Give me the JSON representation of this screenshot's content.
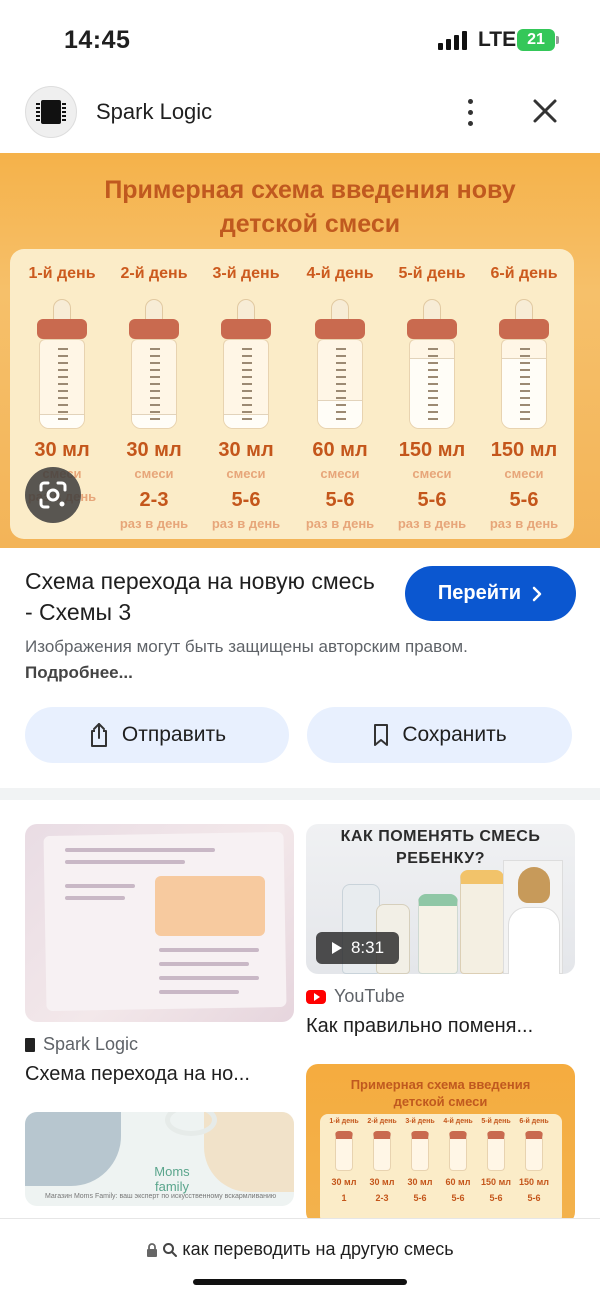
{
  "status_bar": {
    "time": "14:45",
    "network": "LTE",
    "battery": "21",
    "battery_color": "#34c759"
  },
  "header": {
    "source_name": "Spark Logic",
    "logo_icon": "chip-icon",
    "more_icon": "more-vert-icon",
    "close_icon": "close-icon"
  },
  "main_image": {
    "title_line1": "Примерная схема введения нову",
    "title_line2": "детской смеси",
    "columns": [
      {
        "day": "1-й день",
        "volume": "30 мл",
        "label": "смеси",
        "times": "",
        "per_day": "раз в день"
      },
      {
        "day": "2-й день",
        "volume": "30 мл",
        "label": "смеси",
        "times": "2-3",
        "per_day": "раз в день"
      },
      {
        "day": "3-й день",
        "volume": "30 мл",
        "label": "смеси",
        "times": "5-6",
        "per_day": "раз в день"
      },
      {
        "day": "4-й день",
        "volume": "60 мл",
        "label": "смеси",
        "times": "5-6",
        "per_day": "раз в день"
      },
      {
        "day": "5-й день",
        "volume": "150 мл",
        "label": "смеси",
        "times": "5-6",
        "per_day": "раз в день"
      },
      {
        "day": "6-й день",
        "volume": "150 мл",
        "label": "смеси",
        "times": "5-6",
        "per_day": "раз в день"
      }
    ],
    "lens_icon": "google-lens-icon"
  },
  "result": {
    "title": "Схема перехода на новую смесь - Схемы 3",
    "visit_label": "Перейти",
    "notice_text": "Изображения могут быть защищены авторским правом.",
    "notice_more": "Подробнее...",
    "share_label": "Отправить",
    "save_label": "Сохранить",
    "accent_color": "#0b57d0"
  },
  "related": {
    "item1": {
      "source": "Spark Logic",
      "title": "Схема перехода на но..."
    },
    "item2": {
      "headline": "КАК ПОМЕНЯТЬ СМЕСЬ РЕБЕНКУ?",
      "duration": "8:31",
      "source": "YouTube",
      "title": "Как правильно поменя..."
    },
    "item3": {
      "brand": "Moms family",
      "footer": "Магазин Moms Family: ваш эксперт по искусственному вскармливанию"
    },
    "item4": {
      "title_line1": "Примерная схема введения",
      "title_line2": "детской смеси",
      "days": [
        "1-й день",
        "2-й день",
        "3-й день",
        "4-й день",
        "5-й день",
        "6-й день"
      ],
      "volumes": [
        "30 мл",
        "30 мл",
        "30 мл",
        "60 мл",
        "150 мл",
        "150 мл"
      ],
      "times": [
        "1",
        "2-3",
        "5-6",
        "5-6",
        "5-6",
        "5-6"
      ]
    }
  },
  "bottom": {
    "query": "как переводить на другую смесь"
  }
}
